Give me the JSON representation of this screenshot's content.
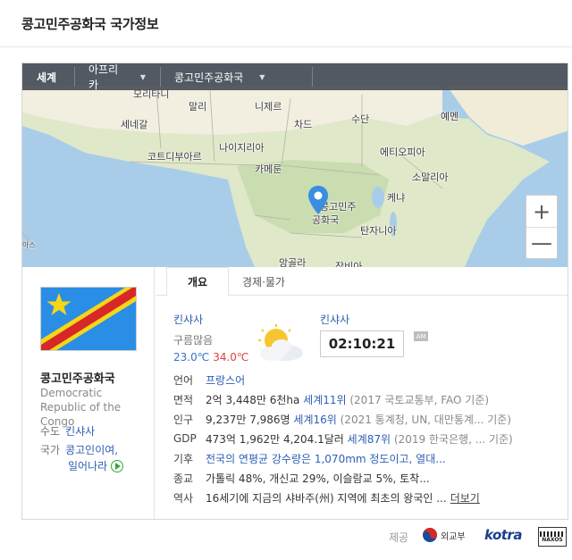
{
  "page": {
    "title": "콩고민주공화국 국가정보"
  },
  "breadcrumb": {
    "world": "세계",
    "continent": "아프리카",
    "country": "콩고민주공화국"
  },
  "map": {
    "labels": {
      "mauritania": "모리타니",
      "mali": "말리",
      "niger": "니제르",
      "sudan": "수단",
      "yemen": "예멘",
      "senegal": "세네갈",
      "chad": "차드",
      "nigeria": "나이지리아",
      "cote_divoire": "코트디부아르",
      "ethiopia": "에티오피아",
      "cameroon": "카메룬",
      "somalia": "소말리아",
      "kenya": "케냐",
      "drc_line1": "콩고민주",
      "drc_line2": "공화국",
      "tanzania": "탄자니아",
      "angola": "앙골라",
      "zambia": "잠비아",
      "edge": "아스"
    },
    "zoom_in": "+",
    "zoom_out": "—"
  },
  "country": {
    "name_ko": "콩고민주공화국",
    "name_en": "Democratic Republic of the Congo",
    "capital_label": "수도",
    "capital": "킨샤사",
    "anthem_label": "국가",
    "anthem_line1": "콩고인이여,",
    "anthem_line2": "일어나라"
  },
  "tabs": [
    {
      "label": "개요",
      "active": true
    },
    {
      "label": "경제·물가",
      "active": false
    }
  ],
  "weather": {
    "city": "킨샤사",
    "condition": "구름많음",
    "low": "23.0℃",
    "high": "34.0℃",
    "icon": "partly-cloudy-icon"
  },
  "clock": {
    "city": "킨샤사",
    "time": "02:10:21",
    "ampm": "AM"
  },
  "info": [
    {
      "k": "언어",
      "parts": [
        {
          "t": "프랑스어",
          "c": "l"
        }
      ]
    },
    {
      "k": "면적",
      "parts": [
        {
          "t": "2억 3,448만 6천ha ",
          "c": "v"
        },
        {
          "t": "세계11위",
          "c": "l"
        },
        {
          "t": " (2017 국토교통부, FAO 기준)",
          "c": "g"
        }
      ]
    },
    {
      "k": "인구",
      "parts": [
        {
          "t": "9,237만 7,986명 ",
          "c": "v"
        },
        {
          "t": "세계16위",
          "c": "l"
        },
        {
          "t": " (2021 통계청, UN, 대만통계... 기준)",
          "c": "g"
        }
      ]
    },
    {
      "k": "GDP",
      "parts": [
        {
          "t": "473억 1,962만 4,204.1달러 ",
          "c": "v"
        },
        {
          "t": "세계87위",
          "c": "l"
        },
        {
          "t": " (2019 한국은행, ... 기준)",
          "c": "g"
        }
      ]
    },
    {
      "k": "기후",
      "parts": [
        {
          "t": "전국의 연평균 강수량은 1,070mm 정도이고, 열대...",
          "c": "l"
        }
      ]
    },
    {
      "k": "종교",
      "parts": [
        {
          "t": "가톨릭 48%, 개신교 29%, 이슬람교 5%, 토착...",
          "c": "v"
        }
      ]
    },
    {
      "k": "역사",
      "parts": [
        {
          "t": "16세기에 지금의 샤바주(州) 지역에 최초의 왕국인 ...",
          "c": "v"
        },
        {
          "t": "더보기",
          "c": "more"
        }
      ]
    }
  ],
  "footer": {
    "provide": "제공",
    "mofa": "외교부",
    "kotra": "kotra",
    "naxos": "NAXOS"
  },
  "colors": {
    "flag_blue": "#2a8ee6",
    "flag_red": "#d62828",
    "flag_yellow": "#f7d618",
    "link": "#2d5fb5",
    "pin": "#3a8de0"
  }
}
